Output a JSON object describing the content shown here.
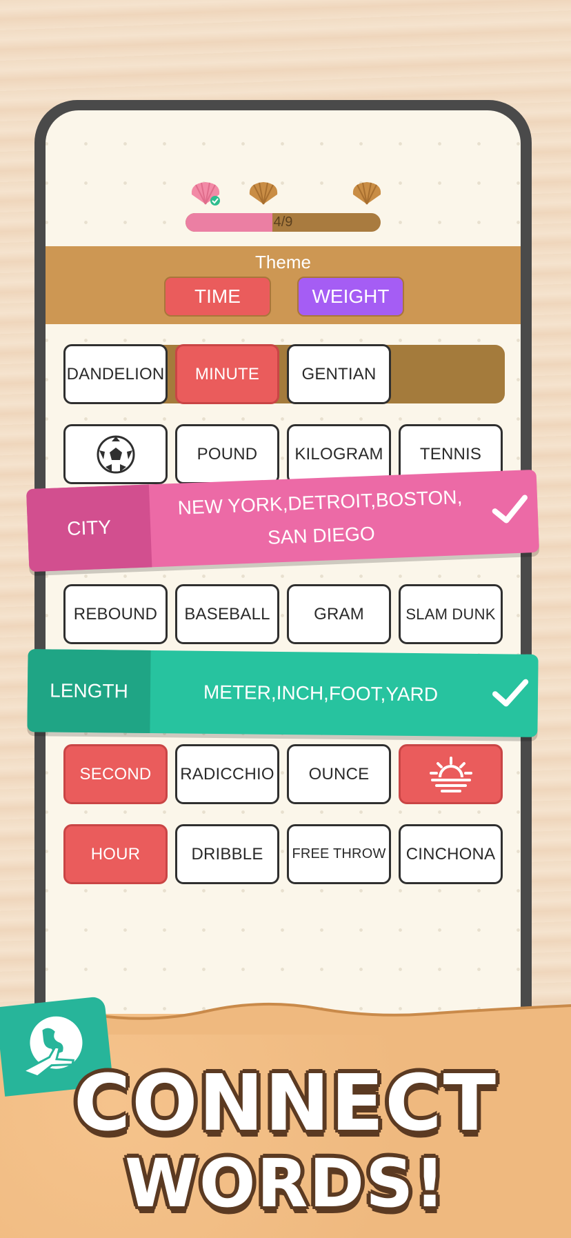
{
  "progress": {
    "text": "4/9",
    "fraction": 0.444
  },
  "theme": {
    "title": "Theme",
    "options": [
      "TIME",
      "WEIGHT"
    ]
  },
  "rows": {
    "r1": [
      "DANDELION",
      "MINUTE",
      "GENTIAN"
    ],
    "r2": [
      "soccer-ball-icon",
      "POUND",
      "KILOGRAM",
      "TENNIS"
    ],
    "r3": [
      "REBOUND",
      "BASEBALL",
      "GRAM",
      "SLAM DUNK"
    ],
    "r4": [
      "SECOND",
      "RADICCHIO",
      "OUNCE",
      "sunset-icon"
    ],
    "r5": [
      "HOUR",
      "DRIBBLE",
      "FREE THROW",
      "CINCHONA"
    ]
  },
  "groups": {
    "city": {
      "label": "CITY",
      "line1": "NEW YORK,DETROIT,BOSTON,",
      "line2": "SAN DIEGO"
    },
    "length": {
      "label": "LENGTH",
      "line1": "METER,INCH,FOOT,YARD"
    }
  },
  "promo": {
    "line1": "CONNECT",
    "line2": "WORDS!"
  },
  "colors": {
    "pink": "#ec6aa6",
    "pink_dark": "#d24f8f",
    "teal": "#27c39f",
    "teal_dark": "#1fa585",
    "red": "#ea5c5c",
    "purple": "#a55df4",
    "brown": "#cd9753"
  }
}
